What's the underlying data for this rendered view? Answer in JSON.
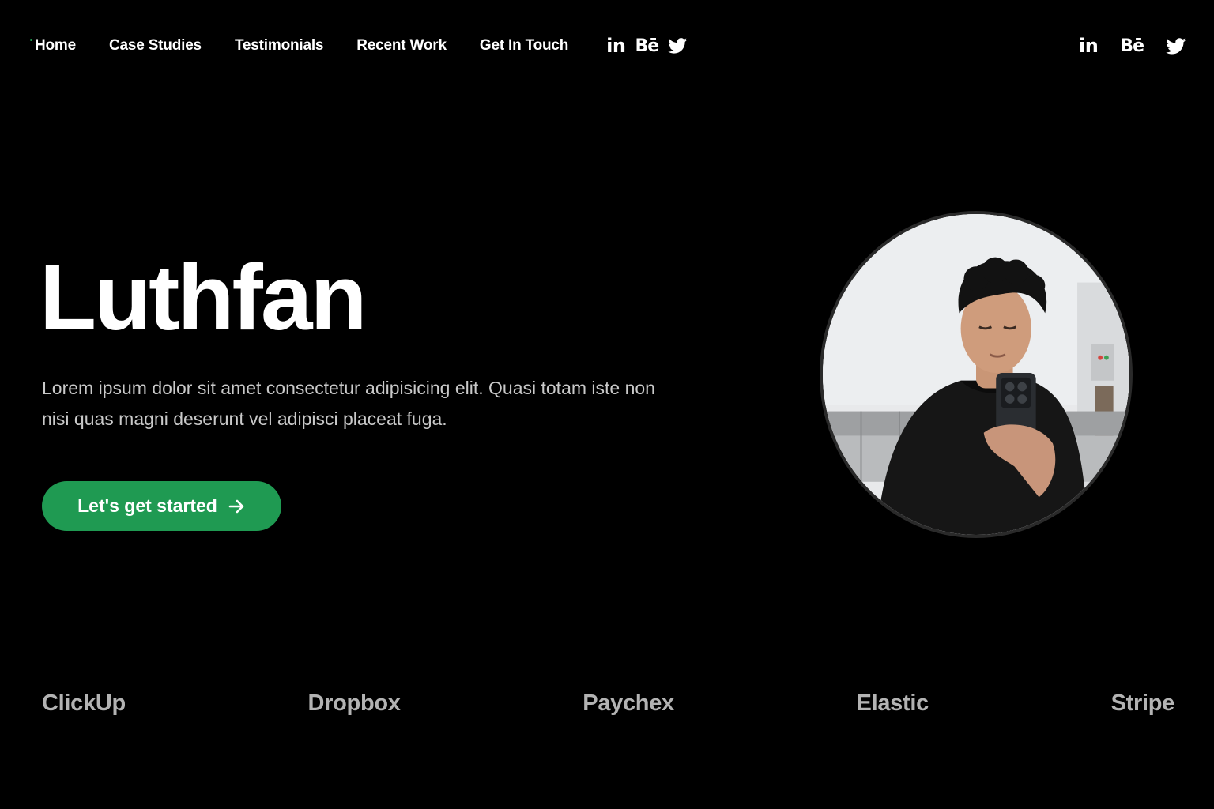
{
  "theme": {
    "accent": "#1f9a52",
    "background": "#000000",
    "text": "#ffffff",
    "muted": "#c9c9c9",
    "logo": "#b3b3b3"
  },
  "nav": {
    "links": [
      {
        "label": "Home",
        "active": true
      },
      {
        "label": "Case Studies"
      },
      {
        "label": "Testimonials"
      },
      {
        "label": "Recent Work"
      },
      {
        "label": "Get In Touch"
      }
    ],
    "social_inline": [
      {
        "icon": "linkedin-icon",
        "text": "in"
      },
      {
        "icon": "behance-icon",
        "text": "Bē"
      },
      {
        "icon": "twitter-icon"
      }
    ],
    "social_right": [
      {
        "icon": "linkedin-icon",
        "text": "in"
      },
      {
        "icon": "behance-icon",
        "text": "Bē"
      },
      {
        "icon": "twitter-icon"
      }
    ]
  },
  "hero": {
    "title": "Luthfan",
    "description": "Lorem ipsum dolor sit amet consectetur adipisicing elit. Quasi totam iste non nisi quas magni deserunt vel adipisci placeat fuga.",
    "cta_label": "Let's get started",
    "cta_icon": "arrow-right-icon"
  },
  "avatar": {
    "icon": "profile-photo"
  },
  "logos": [
    "ClickUp",
    "Dropbox",
    "Paychex",
    "Elastic",
    "Stripe"
  ]
}
